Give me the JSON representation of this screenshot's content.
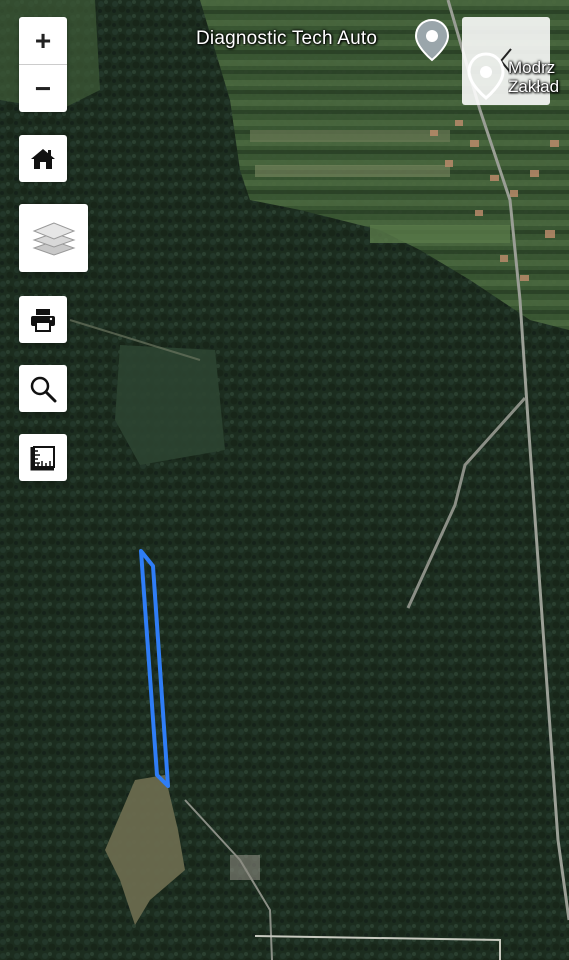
{
  "map": {
    "labels": [
      {
        "id": "poi-1",
        "text": "Diagnostic Tech Auto"
      },
      {
        "id": "poi-2",
        "text": "Modrz Zakład"
      }
    ],
    "feature_color": "#2f7df6"
  },
  "controls": {
    "zoom_in": "+",
    "zoom_out": "−",
    "icons": [
      "home-icon",
      "layers-icon",
      "print-icon",
      "search-icon",
      "measure-icon",
      "chevron-left-icon"
    ]
  }
}
